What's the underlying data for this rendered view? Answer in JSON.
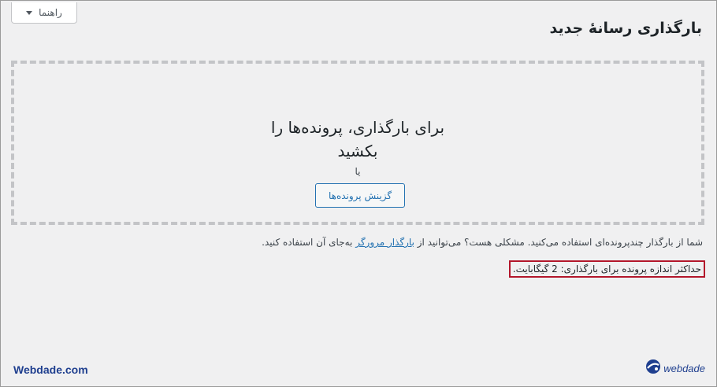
{
  "help_tab": {
    "label": "راهنما"
  },
  "page_title": "بارگذاری رسانهٔ جدید",
  "uploader": {
    "drop_line_1": "برای بارگذاری، پرونده‌ها را",
    "drop_line_2": "بکشید",
    "or_text": "یا",
    "select_button": "گزینش پرونده‌ها"
  },
  "info": {
    "before_link": "شما از بارگذار چندپرونده‌ای استفاده می‌کنید. مشکلی هست؟ می‌توانید از ",
    "link": "بارگذار مرورگر",
    "after_link": " به‌جای آن استفاده کنید."
  },
  "max_upload": "حداکثر اندازه پرونده برای بارگذاری: 2 گیگابایت.",
  "watermark": {
    "left_text": "Webdade.com",
    "right_text": "webdade",
    "brand_color": "#1f3f8f"
  },
  "colors": {
    "accent": "#2271b1",
    "highlight_border": "#b3162b"
  }
}
